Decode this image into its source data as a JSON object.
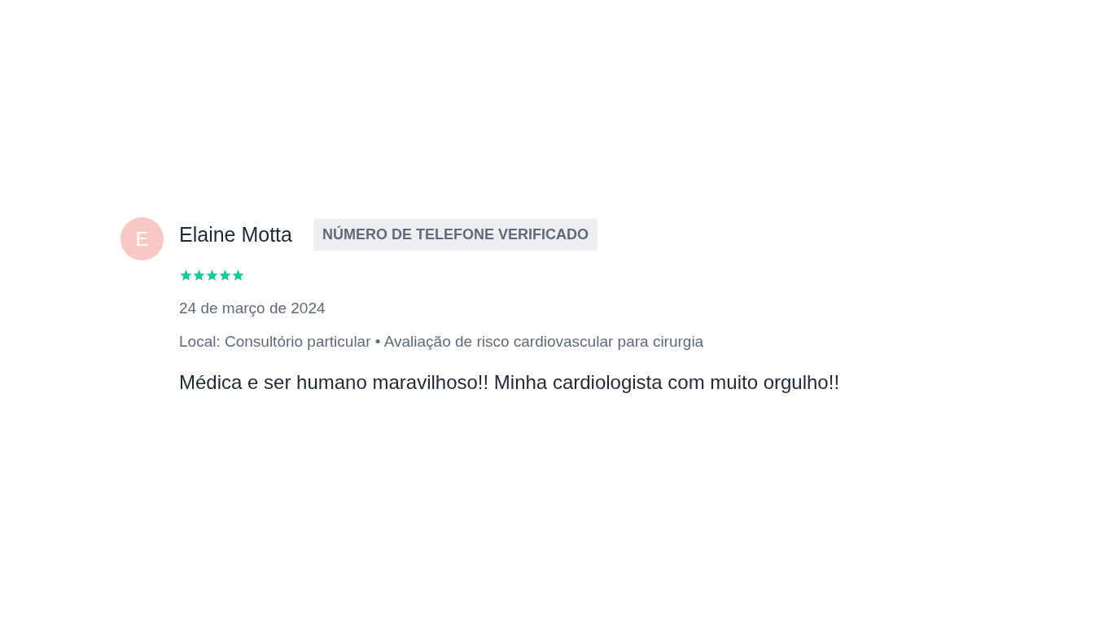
{
  "review": {
    "avatar_initial": "E",
    "author": "Elaine Motta",
    "badge": "NÚMERO DE TELEFONE VERIFICADO",
    "stars": 5,
    "date": "24 de março de 2024",
    "details": "Local: Consultório particular • Avaliação de risco cardiovascular para cirurgia",
    "text": "Médica e ser humano maravilhoso!! Minha cardiologista com muito orgulho!!"
  }
}
